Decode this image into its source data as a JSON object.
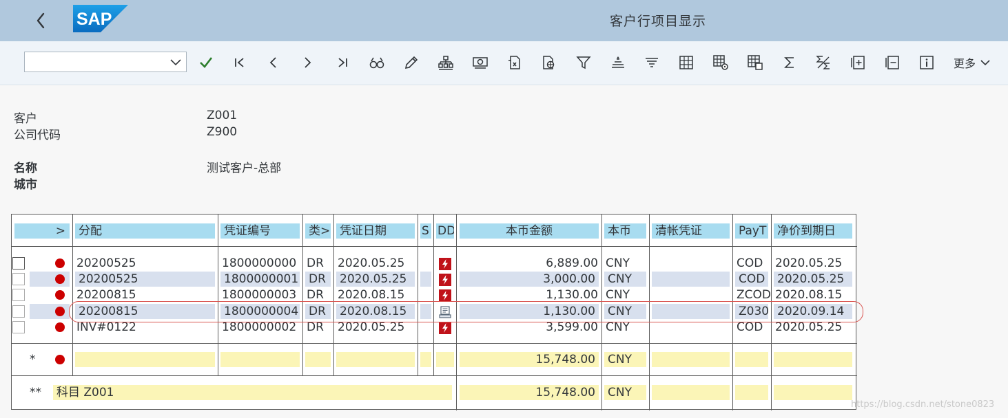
{
  "app": {
    "title": "客户行项目显示",
    "logo_text": "SAP"
  },
  "toolbar": {
    "command_value": "",
    "more_label": "更多",
    "icons": [
      "check-icon",
      "first-page-icon",
      "previous-icon",
      "next-icon",
      "last-page-icon",
      "find-icon",
      "edit-icon",
      "layout-icon",
      "currency-icon",
      "export-icon",
      "globe-doc-icon",
      "filter-icon",
      "sort-ascending-icon",
      "sort-descending-icon",
      "grid-icon",
      "grid-settings-icon",
      "grid-select-icon",
      "sum-icon",
      "subtotal-icon",
      "expand-icon",
      "collapse-icon",
      "info-icon"
    ]
  },
  "header": {
    "customer_label": "客户",
    "customer_value": "Z001",
    "company_label": "公司代码",
    "company_value": "Z900",
    "name_label": "名称",
    "name_value": "测试客户-总部",
    "city_label": "城市",
    "city_value": ""
  },
  "table": {
    "columns": {
      "status": ">",
      "assignment": "分配",
      "doc_no": "凭证编号",
      "type": "类>",
      "doc_date": "凭证日期",
      "s": "S",
      "dd": "DD",
      "amount": "本币金额",
      "currency": "本币",
      "clearing_doc": "清帐凭证",
      "payt": "PayT",
      "net_due": "净价到期日"
    },
    "rows": [
      {
        "assignment": "20200525",
        "doc_no": "1800000000",
        "type": "DR",
        "doc_date": "2020.05.25",
        "dd_icon": "overdue-icon",
        "amount": "6,889.00",
        "currency": "CNY",
        "clearing_doc": "",
        "payt": "COD",
        "net_due": "2020.05.25"
      },
      {
        "assignment": "20200525",
        "doc_no": "1800000001",
        "type": "DR",
        "doc_date": "2020.05.25",
        "dd_icon": "overdue-icon",
        "amount": "3,000.00",
        "currency": "CNY",
        "clearing_doc": "",
        "payt": "COD",
        "net_due": "2020.05.25"
      },
      {
        "assignment": "20200815",
        "doc_no": "1800000003",
        "type": "DR",
        "doc_date": "2020.08.15",
        "dd_icon": "overdue-icon",
        "amount": "1,130.00",
        "currency": "CNY",
        "clearing_doc": "",
        "payt": "ZCOD",
        "net_due": "2020.08.15"
      },
      {
        "assignment": "20200815",
        "doc_no": "1800000004",
        "type": "DR",
        "doc_date": "2020.08.15",
        "dd_icon": "not-due-icon",
        "amount": "1,130.00",
        "currency": "CNY",
        "clearing_doc": "",
        "payt": "Z030",
        "net_due": "2020.09.14"
      },
      {
        "assignment": "INV#0122",
        "doc_no": "1800000002",
        "type": "DR",
        "doc_date": "2020.05.25",
        "dd_icon": "overdue-icon",
        "amount": "3,599.00",
        "currency": "CNY",
        "clearing_doc": "",
        "payt": "COD",
        "net_due": "2020.05.25"
      }
    ],
    "subtotal": {
      "marker": "*",
      "amount": "15,748.00",
      "currency": "CNY"
    },
    "total": {
      "marker": "**",
      "label": "科目 Z001",
      "amount": "15,748.00",
      "currency": "CNY"
    }
  },
  "colors": {
    "shellbar": "#b0c8dd",
    "header_cell": "#a8dcf0",
    "selected_row": "#d8e0ee",
    "total_row": "#fbf5b7",
    "status_red": "#cc0000",
    "highlight_ring": "#d9534f"
  },
  "watermark": "https://blog.csdn.net/stone0823"
}
